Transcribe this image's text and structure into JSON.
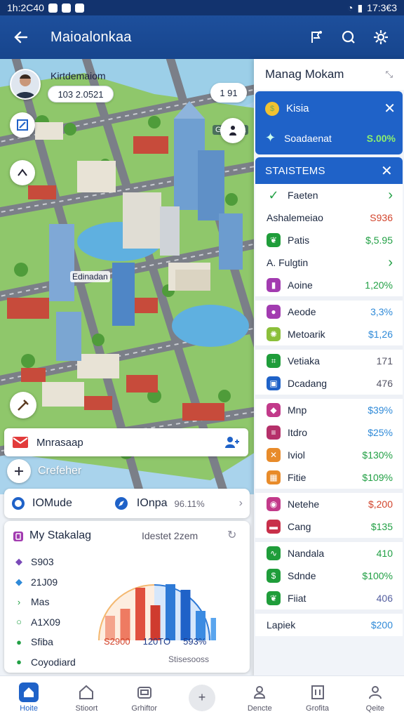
{
  "status_bar": {
    "left_time": "1h:2C40",
    "right_time": "17:3€3"
  },
  "header": {
    "title": "Maioalonkaa"
  },
  "user": {
    "name": "Kirtdemaiom",
    "stat": "103 2.0521"
  },
  "map": {
    "chip": "1 91",
    "badge": "Ginqcsta",
    "label": "Edinadan"
  },
  "banner": {
    "label": "Mnrasaap"
  },
  "create": {
    "label": "Crefeher"
  },
  "modes": {
    "mode1": "IOMude",
    "mode2": "IOnpa",
    "mode2_value": "96.11%"
  },
  "stat_card": {
    "title": "My Stakalag",
    "right_text": "Idestet 2zem",
    "items": [
      {
        "icon": "diamond-icon",
        "label": "S903"
      },
      {
        "icon": "diamond-icon",
        "label": "21J09"
      },
      {
        "icon": "chevron-right-icon",
        "label": "Mas"
      },
      {
        "icon": "circle-icon",
        "label": "A1X09"
      },
      {
        "icon": "circle-icon",
        "label": "Sfiba"
      },
      {
        "icon": "circle-icon",
        "label": "Coyodiard"
      }
    ],
    "values": [
      "S2900",
      "120TO",
      "593%"
    ],
    "footer": "Stisesooss",
    "chart_bars": [
      {
        "value": 35,
        "color": "#f4a48c"
      },
      {
        "value": 45,
        "color": "#ee7b62"
      },
      {
        "value": 75,
        "color": "#e0503e"
      },
      {
        "value": 50,
        "color": "#cf3b2e"
      },
      {
        "value": 80,
        "color": "#2e7ad6"
      },
      {
        "value": 72,
        "color": "#1f62c8"
      },
      {
        "value": 42,
        "color": "#3b8be2"
      },
      {
        "value": 32,
        "color": "#5aa5ee"
      }
    ]
  },
  "panel": {
    "title": "Manag Mokam",
    "kisa": {
      "label": "Kisia"
    },
    "sodamat": {
      "label": "Soadaenat",
      "value": "S.00%"
    },
    "statistics_title": "STAISTEMS",
    "rows": [
      {
        "icon": "check-icon",
        "label": "Faeten",
        "value": "›",
        "color": "#22a045",
        "vcolor": "#22a045"
      },
      {
        "icon": "none",
        "label": "Ashalemeiao",
        "value": "S936",
        "color": "#fff",
        "vcolor": "#d2442c"
      },
      {
        "icon": "leaf-icon",
        "label": "Patis",
        "value": "$,5.95",
        "color": "#1f9d3a",
        "vcolor": "#22a045"
      },
      {
        "icon": "none",
        "label": "A. Fulgtin",
        "value": "›",
        "color": "#fff",
        "vcolor": "#22a045"
      },
      {
        "icon": "book-icon",
        "label": "Aoine",
        "value": "1,20%",
        "color": "#a23bb0",
        "vcolor": "#22a045"
      },
      {
        "icon": "sep",
        "label": "",
        "value": "",
        "color": "",
        "vcolor": ""
      },
      {
        "icon": "ball-icon",
        "label": "Aeode",
        "value": "3,3%",
        "color": "#a23bb0",
        "vcolor": "#2f8ad8"
      },
      {
        "icon": "sun-icon",
        "label": "Metoarik",
        "value": "$1,26",
        "color": "#8bbf3a",
        "vcolor": "#2f8ad8"
      },
      {
        "icon": "sep",
        "label": "",
        "value": "",
        "color": "",
        "vcolor": ""
      },
      {
        "icon": "grid-icon",
        "label": "Vetiaka",
        "value": "171",
        "color": "#1f9d3a",
        "vcolor": "#556"
      },
      {
        "icon": "card-icon",
        "label": "Dcadang",
        "value": "476",
        "color": "#1f62c8",
        "vcolor": "#556"
      },
      {
        "icon": "sep",
        "label": "",
        "value": "",
        "color": "",
        "vcolor": ""
      },
      {
        "icon": "gem-icon",
        "label": "Mnp",
        "value": "$39%",
        "color": "#c23a8a",
        "vcolor": "#2f8ad8"
      },
      {
        "icon": "stack-icon",
        "label": "Itdro",
        "value": "$25%",
        "color": "#b5306a",
        "vcolor": "#2f8ad8"
      },
      {
        "icon": "cross-icon",
        "label": "Iviol",
        "value": "$130%",
        "color": "#e88b2a",
        "vcolor": "#22a045"
      },
      {
        "icon": "tile-icon",
        "label": "Fitie",
        "value": "$109%",
        "color": "#e88b2a",
        "vcolor": "#22a045"
      },
      {
        "icon": "sep",
        "label": "",
        "value": "",
        "color": "",
        "vcolor": ""
      },
      {
        "icon": "ring-icon",
        "label": "Netehe",
        "value": "$,200",
        "color": "#c23a8a",
        "vcolor": "#d2442c"
      },
      {
        "icon": "tag-icon",
        "label": "Cang",
        "value": "$135",
        "color": "#c8304a",
        "vcolor": "#22a045"
      },
      {
        "icon": "sep",
        "label": "",
        "value": "",
        "color": "",
        "vcolor": ""
      },
      {
        "icon": "wave-icon",
        "label": "Nandala",
        "value": "410",
        "color": "#1f9d3a",
        "vcolor": "#22a045"
      },
      {
        "icon": "dollar-icon",
        "label": "Sdnde",
        "value": "$100%",
        "color": "#1f9d3a",
        "vcolor": "#22a045"
      },
      {
        "icon": "leaf-icon",
        "label": "Fiiat",
        "value": "406",
        "color": "#1f9d3a",
        "vcolor": "#5560a0"
      },
      {
        "icon": "sep",
        "label": "",
        "value": "",
        "color": "",
        "vcolor": ""
      },
      {
        "icon": "none",
        "label": "Lapiek",
        "value": "$200",
        "color": "#fff",
        "vcolor": "#2f8ad8"
      }
    ]
  },
  "nav": [
    {
      "label": "Hoite",
      "icon": "home-icon"
    },
    {
      "label": "Stioort",
      "icon": "house-icon"
    },
    {
      "label": "Grhiftor",
      "icon": "camera-icon"
    },
    {
      "label": "",
      "icon": "plus-icon"
    },
    {
      "label": "Dencte",
      "icon": "bag-icon"
    },
    {
      "label": "Grofita",
      "icon": "building-icon"
    },
    {
      "label": "Qeite",
      "icon": "person-icon"
    }
  ]
}
